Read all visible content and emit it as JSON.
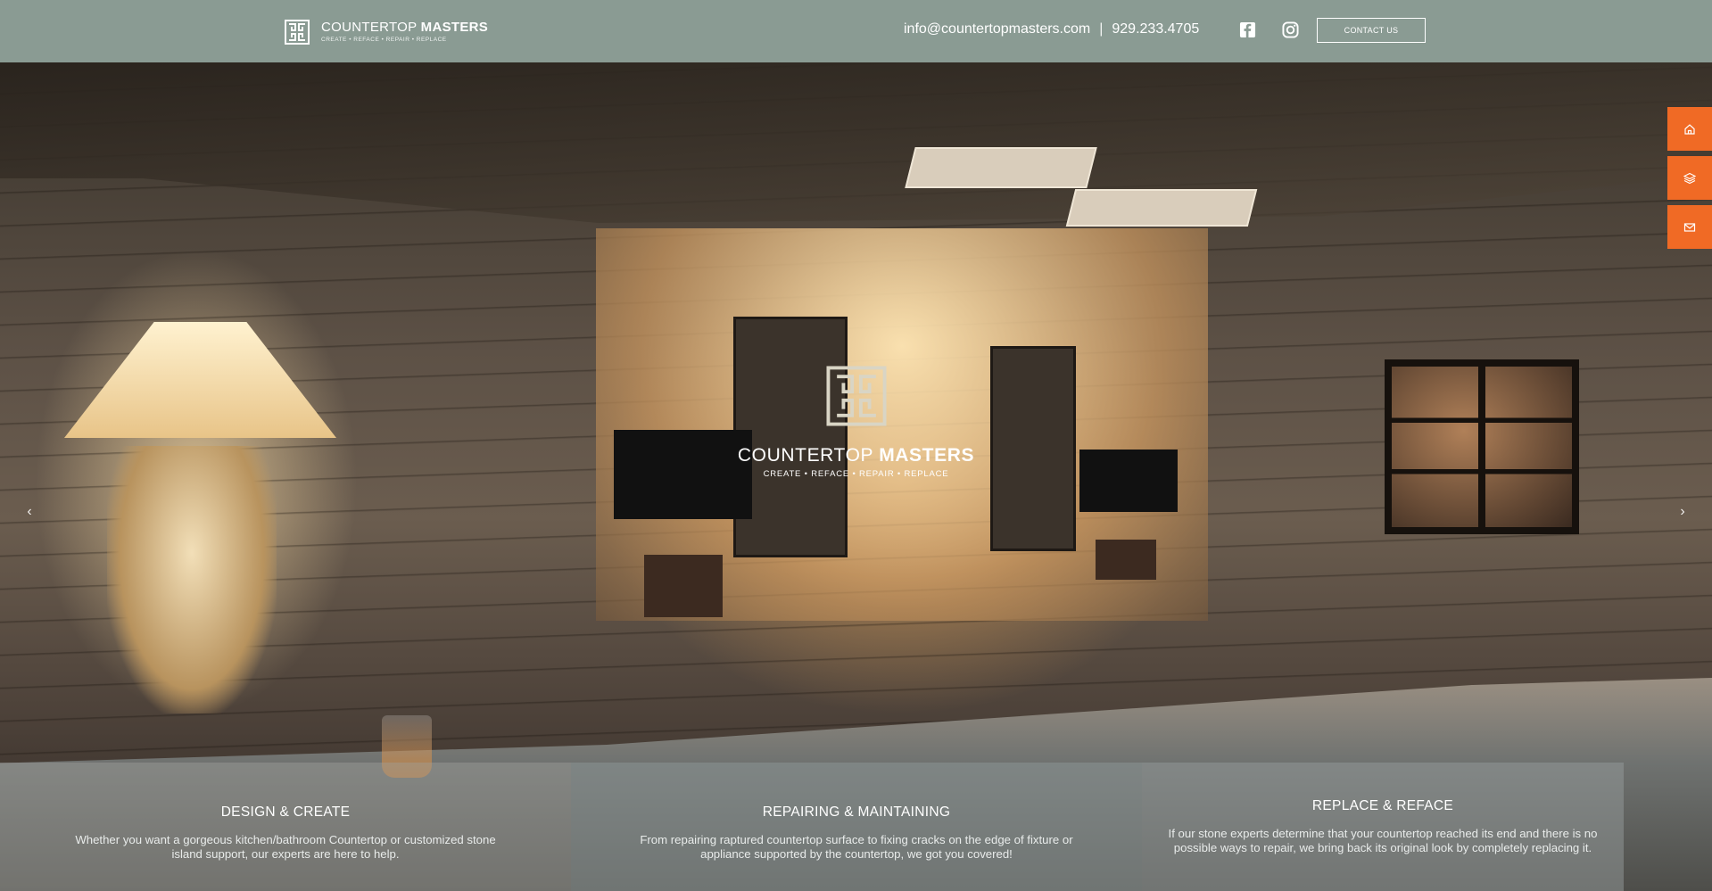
{
  "header": {
    "logo_name_light": "COUNTERTOP ",
    "logo_name_bold": "MASTERS",
    "logo_tagline": "CREATE • REFACE • REPAIR • REPLACE",
    "email": "info@countertopmasters.com",
    "separator": "|",
    "phone": "929.233.4705",
    "contact_button": "CONTACT US",
    "facebook_icon": "facebook-icon",
    "instagram_icon": "instagram-icon",
    "background_color": "#8a9b93"
  },
  "hero": {
    "brand_name_light": "COUNTERTOP ",
    "brand_name_bold": "MASTERS",
    "brand_tagline": "CREATE • REFACE • REPAIR • REPLACE",
    "prev_arrow": "‹",
    "next_arrow": "›"
  },
  "side_dock": {
    "accent_color": "#f06a25",
    "icons": [
      "home-icon",
      "layers-icon",
      "mail-icon"
    ]
  },
  "features": [
    {
      "title": "DESIGN & CREATE",
      "text": "Whether you want a gorgeous kitchen/bathroom Countertop or customized stone island support, our experts are here to help."
    },
    {
      "title": "REPAIRING & MAINTAINING",
      "text": "From repairing raptured countertop surface to fixing cracks on the edge of fixture or appliance supported by the countertop, we got you covered!"
    },
    {
      "title": "REPLACE & REFACE",
      "text": "If our stone experts determine that your countertop reached its end and there is no possible ways to repair, we bring back its original look by completely replacing it."
    }
  ]
}
